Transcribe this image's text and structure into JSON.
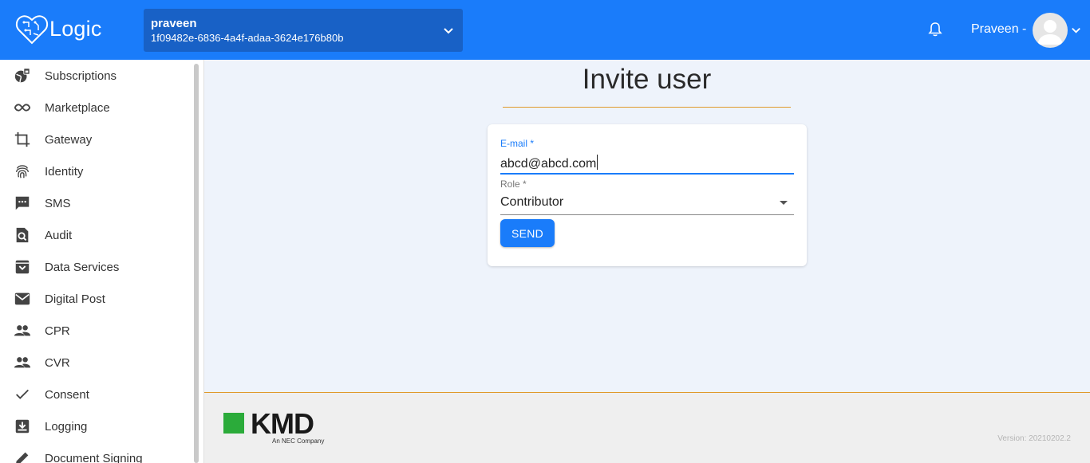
{
  "header": {
    "app_name": "Logic",
    "tenant_name": "praveen",
    "tenant_id": "1f09482e-6836-4a4f-adaa-3624e176b80b",
    "user_name": "Praveen -"
  },
  "sidebar": {
    "items": [
      {
        "label": "Subscriptions",
        "icon": "subscriptions-icon"
      },
      {
        "label": "Marketplace",
        "icon": "infinity-icon"
      },
      {
        "label": "Gateway",
        "icon": "crop-icon"
      },
      {
        "label": "Identity",
        "icon": "fingerprint-icon"
      },
      {
        "label": "SMS",
        "icon": "sms-icon"
      },
      {
        "label": "Audit",
        "icon": "audit-search-icon"
      },
      {
        "label": "Data Services",
        "icon": "archive-icon"
      },
      {
        "label": "Digital Post",
        "icon": "mail-icon"
      },
      {
        "label": "CPR",
        "icon": "people-icon"
      },
      {
        "label": "CVR",
        "icon": "people-icon"
      },
      {
        "label": "Consent",
        "icon": "check-icon"
      },
      {
        "label": "Logging",
        "icon": "download-box-icon"
      },
      {
        "label": "Document Signing",
        "icon": "pen-icon"
      }
    ]
  },
  "main": {
    "title": "Invite user",
    "form": {
      "email_label": "E-mail *",
      "email_value": "abcd@abcd.com",
      "role_label": "Role *",
      "role_value": "Contributor",
      "send_label": "SEND"
    }
  },
  "footer": {
    "brand": "KMD",
    "brand_sub": "An NEC Company",
    "version": "Version: 20210202.2"
  },
  "colors": {
    "primary": "#1a7cfa",
    "tenant_bg": "#1861c6",
    "accent_rule": "#e09a2b",
    "kmd_green": "#2bab3a"
  }
}
